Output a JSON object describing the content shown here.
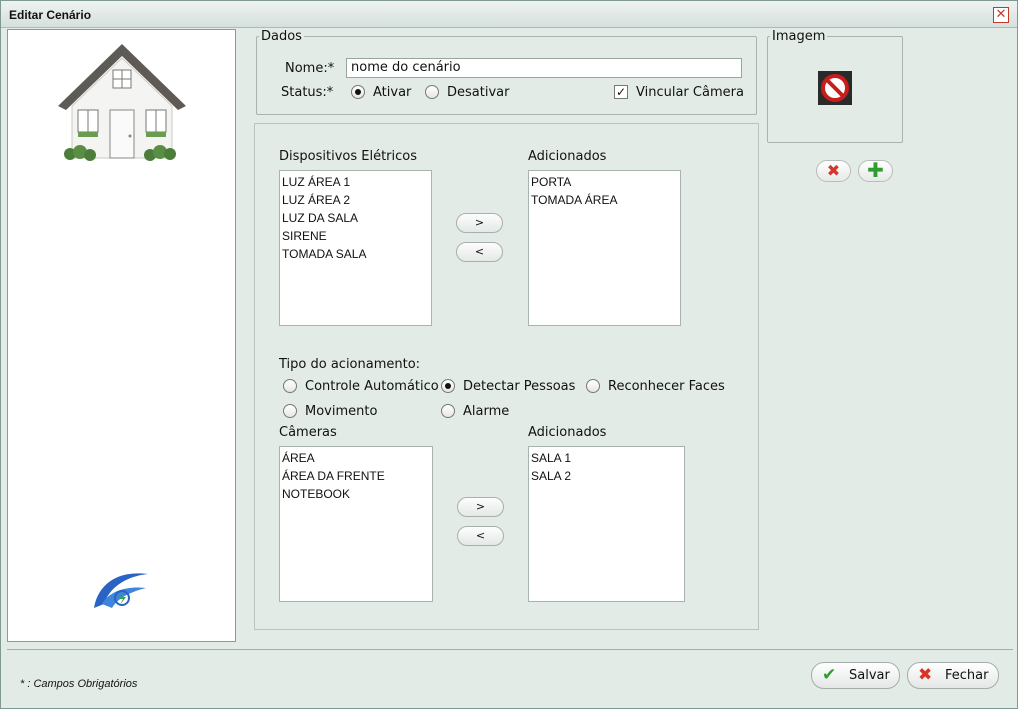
{
  "window": {
    "title": "Editar Cenário",
    "close_glyph": "✕"
  },
  "dados": {
    "legend": "Dados",
    "nome_label": "Nome:*",
    "nome_value": "nome do cenário",
    "status_label": "Status:*",
    "status_options": [
      "Ativar",
      "Desativar"
    ],
    "status_selected": "Ativar",
    "vincular_label": "Vincular Câmera",
    "vincular_checked": true
  },
  "imagem": {
    "legend": "Imagem",
    "placeholder_icon": "no-image-icon"
  },
  "dispositivos": {
    "available_label": "Dispositivos Elétricos",
    "available": [
      "LUZ ÁREA 1",
      "LUZ ÁREA 2",
      "LUZ DA SALA",
      "SIRENE",
      "TOMADA SALA"
    ],
    "added_label": "Adicionados",
    "added": [
      "PORTA",
      "TOMADA ÁREA"
    ],
    "add_button": ">",
    "remove_button": "<"
  },
  "acionamento": {
    "label": "Tipo do acionamento:",
    "options": [
      "Controle Automático",
      "Detectar Pessoas",
      "Reconhecer Faces",
      "Movimento",
      "Alarme"
    ],
    "selected": "Detectar Pessoas"
  },
  "cameras": {
    "available_label": "Câmeras",
    "available": [
      "ÁREA",
      "ÁREA DA FRENTE",
      "NOTEBOOK"
    ],
    "added_label": "Adicionados",
    "added": [
      "SALA 1",
      "SALA 2"
    ],
    "add_button": ">",
    "remove_button": "<"
  },
  "footer": {
    "note": "* : Campos Obrigatórios",
    "save_label": "Salvar",
    "close_label": "Fechar"
  },
  "colors": {
    "accent_green": "#2e9e2e",
    "danger_red": "#d7342a",
    "window_bg": "#e3ebe7"
  }
}
